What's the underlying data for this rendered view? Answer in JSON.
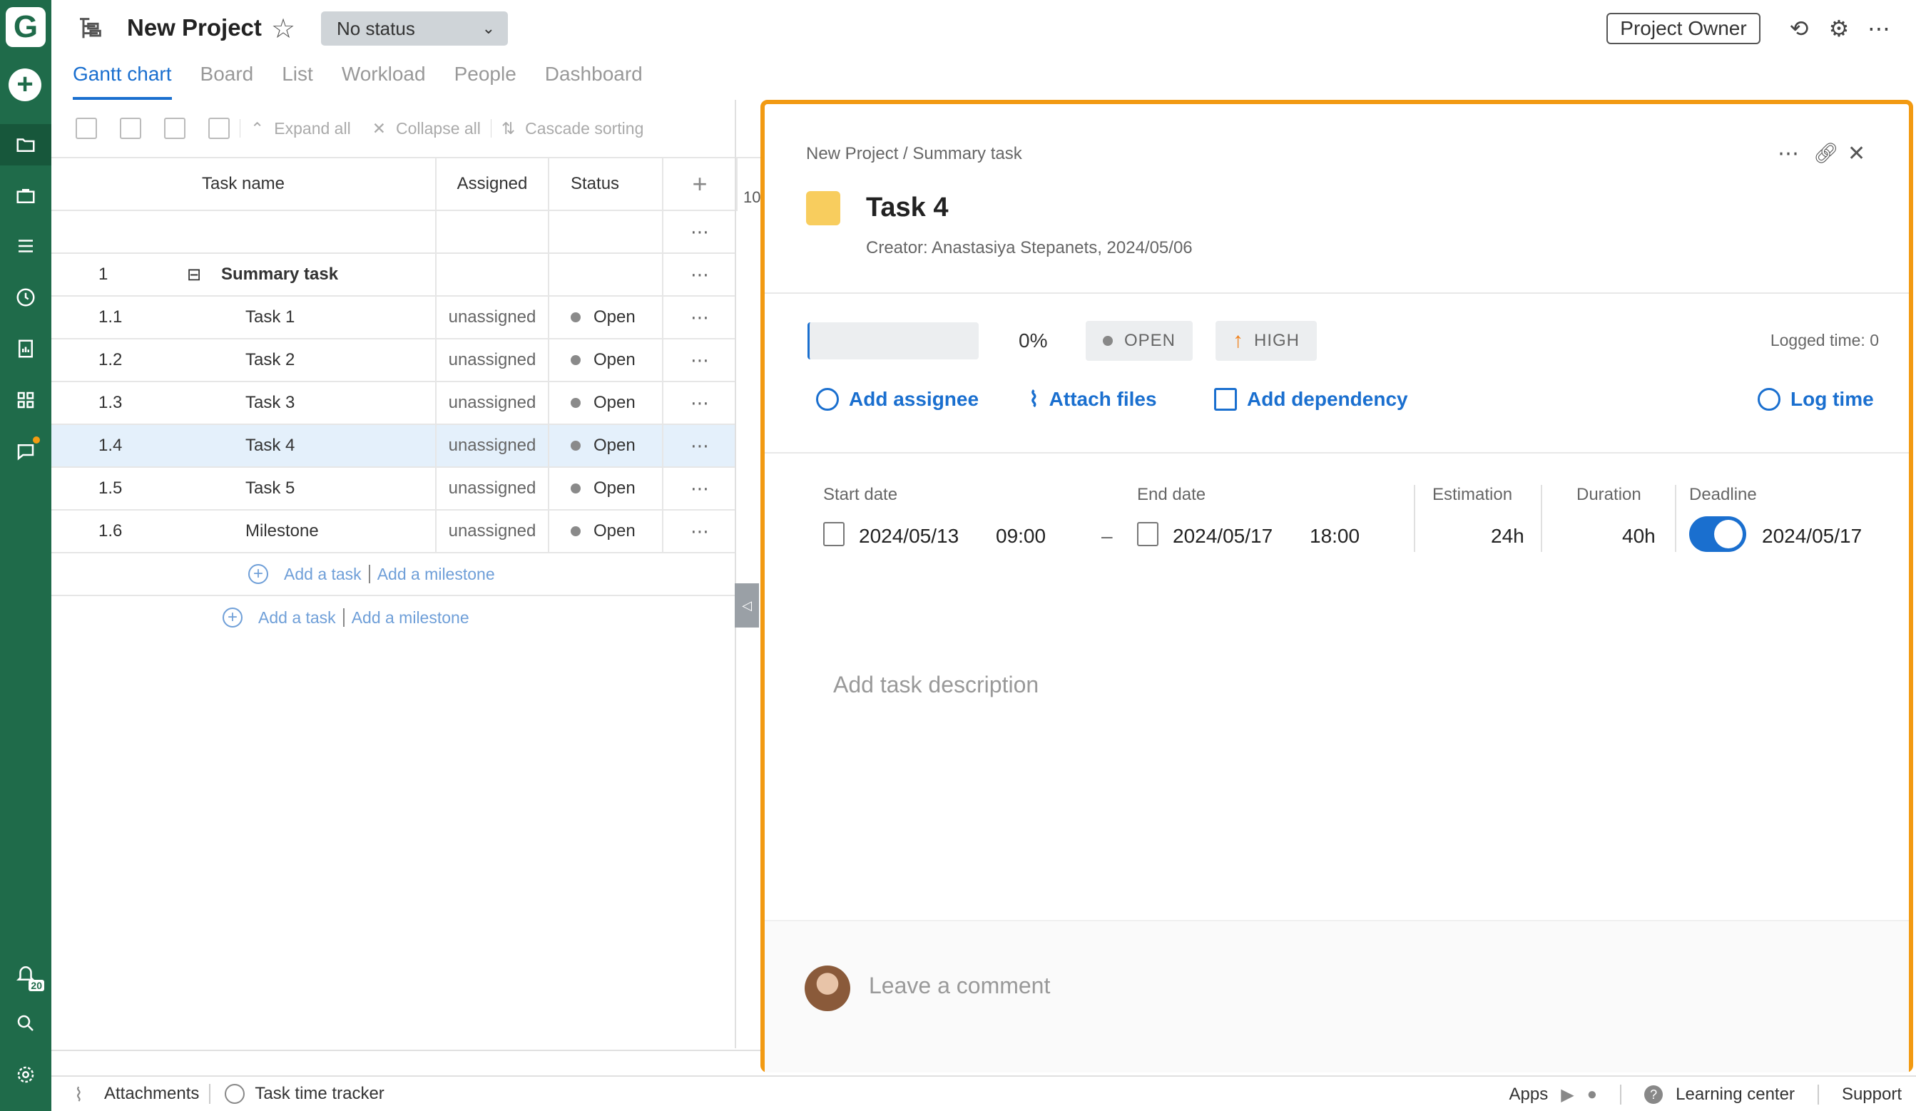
{
  "app": {
    "logo": "G",
    "notification_count": "20"
  },
  "header": {
    "project_title": "New Project",
    "status_dropdown": "No status",
    "owner_button": "Project Owner"
  },
  "tabs": [
    {
      "label": "Gantt chart",
      "active": true
    },
    {
      "label": "Board"
    },
    {
      "label": "List"
    },
    {
      "label": "Workload"
    },
    {
      "label": "People"
    },
    {
      "label": "Dashboard"
    }
  ],
  "toolbar": {
    "expand_all": "Expand all",
    "collapse_all": "Collapse all",
    "cascade_sorting": "Cascade sorting"
  },
  "grid": {
    "columns": {
      "task_name": "Task name",
      "assigned": "Assigned",
      "status": "Status"
    },
    "gantt_header_partial": "10",
    "summary": {
      "num": "1",
      "name": "Summary task"
    },
    "rows": [
      {
        "num": "1.1",
        "name": "Task 1",
        "assigned": "unassigned",
        "status": "Open"
      },
      {
        "num": "1.2",
        "name": "Task 2",
        "assigned": "unassigned",
        "status": "Open"
      },
      {
        "num": "1.3",
        "name": "Task 3",
        "assigned": "unassigned",
        "status": "Open"
      },
      {
        "num": "1.4",
        "name": "Task 4",
        "assigned": "unassigned",
        "status": "Open"
      },
      {
        "num": "1.5",
        "name": "Task 5",
        "assigned": "unassigned",
        "status": "Open"
      },
      {
        "num": "1.6",
        "name": "Milestone",
        "assigned": "unassigned",
        "status": "Open"
      }
    ],
    "add_task": "Add a task",
    "add_milestone": "Add a milestone"
  },
  "panel": {
    "breadcrumb": "New Project / Summary task",
    "title": "Task 4",
    "creator": "Creator: Anastasiya Stepanets, 2024/05/06",
    "progress_percent": "0%",
    "status": "OPEN",
    "priority": "HIGH",
    "logged_time": "Logged time: 0",
    "actions": {
      "add_assignee": "Add assignee",
      "attach_files": "Attach files",
      "add_dependency": "Add dependency",
      "log_time": "Log time"
    },
    "labels": {
      "start_date": "Start date",
      "end_date": "End date",
      "estimation": "Estimation",
      "duration": "Duration",
      "deadline": "Deadline"
    },
    "start_date": "2024/05/13",
    "start_time": "09:00",
    "dash": "–",
    "end_date": "2024/05/17",
    "end_time": "18:00",
    "estimation": "24h",
    "duration": "40h",
    "deadline": "2024/05/17",
    "description_placeholder": "Add task description",
    "comment_placeholder": "Leave a comment"
  },
  "footer": {
    "attachments": "Attachments",
    "time_tracker": "Task time tracker",
    "apps": "Apps",
    "learning_center": "Learning center",
    "support": "Support"
  },
  "colors": {
    "sidebar": "#1f6b4a",
    "accent": "#1a6fcf",
    "highlight_border": "#f29a12",
    "task_color": "#f8cd5e"
  }
}
